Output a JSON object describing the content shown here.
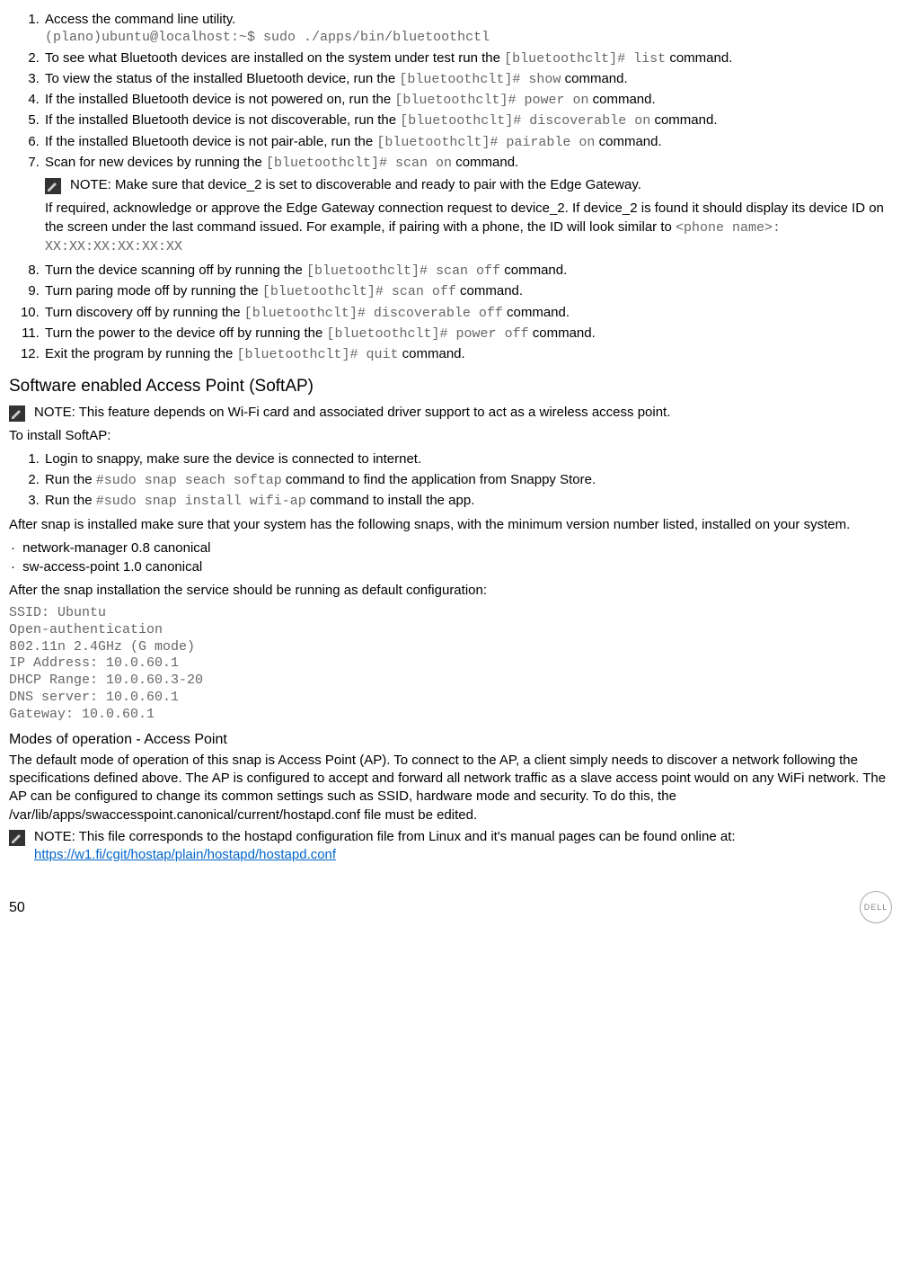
{
  "steps_a": {
    "s1": {
      "text": "Access the command line utility.",
      "cmd": "(plano)ubuntu@localhost:~$ sudo ./apps/bin/bluetoothctl"
    },
    "s2": {
      "pre": "To see what Bluetooth devices are installed on the system under test run the ",
      "code": "[bluetoothclt]# list",
      "post": " command."
    },
    "s3": {
      "pre": "To view the status of the installed Bluetooth device, run the ",
      "code": "[bluetoothclt]# show",
      "post": " command."
    },
    "s4": {
      "pre": "If the installed Bluetooth device is not powered on, run the ",
      "code": "[bluetoothclt]# power on",
      "post": " command."
    },
    "s5": {
      "pre": "If the installed Bluetooth device is not discoverable, run the ",
      "code": "[bluetoothclt]# discoverable on",
      "post": " command."
    },
    "s6": {
      "pre": "If the installed Bluetooth device is not pair-able, run the ",
      "code": "[bluetoothclt]# pairable on",
      "post": " command."
    },
    "s7": {
      "pre": "Scan for new devices by running the ",
      "code": "[bluetoothclt]# scan on",
      "post": " command."
    },
    "s7_note": "NOTE: Make sure that device_2 is set to discoverable and ready to pair with the Edge Gateway.",
    "s7_extra_pre": "If required, acknowledge or approve the Edge Gateway connection request to device_2. If device_2 is found it should display its device ID on the screen under the last command issued. For example, if pairing with a phone, the ID will look similar to ",
    "s7_extra_code": "<phone name>: XX:XX:XX:XX:XX:XX",
    "s8": {
      "pre": "Turn the device scanning off by running the ",
      "code": "[bluetoothclt]# scan off",
      "post": " command."
    },
    "s9": {
      "pre": "Turn paring mode off by running the ",
      "code": "[bluetoothclt]# scan off",
      "post": " command."
    },
    "s10": {
      "pre": "Turn discovery off by running the ",
      "code": "[bluetoothclt]# discoverable off",
      "post": " command."
    },
    "s11": {
      "pre": "Turn the power to the device off by running the ",
      "code": "[bluetoothclt]# power off",
      "post": " command."
    },
    "s12": {
      "pre": "Exit the program by running the ",
      "code": "[bluetoothclt]# quit",
      "post": " command."
    }
  },
  "softap": {
    "heading": "Software enabled Access Point (SoftAP)",
    "note": "NOTE: This feature depends on Wi-Fi card and associated driver support to act as a wireless access point.",
    "install_heading": "To install SoftAP:",
    "steps": {
      "s1": "Login to snappy, make sure the device is connected to internet.",
      "s2_pre": "Run the ",
      "s2_code": "#sudo snap seach softap",
      "s2_post": " command to find the application from Snappy Store.",
      "s3_pre": "Run the ",
      "s3_code": "#sudo snap install wifi-ap",
      "s3_post": " command to install the app."
    },
    "after_install": "After snap is installed make sure that your system has the following snaps, with the minimum version number listed, installed on your system.",
    "bullets": {
      "b1": "network-manager 0.8 canonical",
      "b2": "sw-access-point 1.0 canonical"
    },
    "after_snap": "After the snap installation the service should be running as default configuration:",
    "config": "SSID: Ubuntu\nOpen-authentication\n802.11n 2.4GHz (G mode)\nIP Address: 10.0.60.1\nDHCP Range: 10.0.60.3-20\nDNS server: 10.0.60.1\nGateway: 10.0.60.1"
  },
  "modes": {
    "heading": "Modes of operation - Access Point",
    "body": "The default mode of operation of this snap is Access Point (AP). To connect to the AP, a client simply needs to discover a network following the specifications defined above. The AP is configured to accept and forward all network traffic as a slave access point would on any WiFi network. The AP can be configured to change its common settings such as SSID, hardware mode and security. To do this, the /var/lib/apps/swaccesspoint.canonical/current/hostapd.conf file must be edited.",
    "note_pre": "NOTE: This file corresponds to the hostapd configuration file from Linux and it's manual pages can be found online at: ",
    "note_link": "https://w1.fi/cgit/hostap/plain/hostapd/hostapd.conf"
  },
  "page_number": "50",
  "logo_text": "DELL"
}
